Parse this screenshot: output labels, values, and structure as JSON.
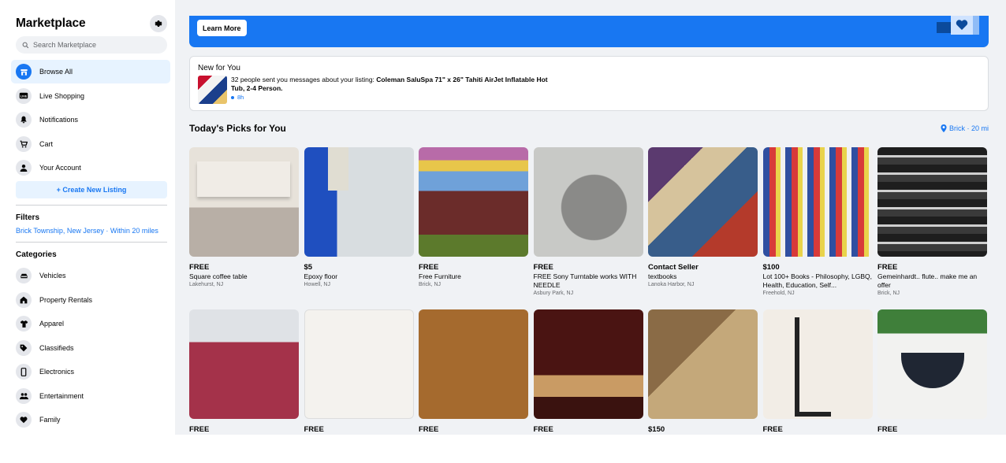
{
  "sidebar": {
    "title": "Marketplace",
    "search_placeholder": "Search Marketplace",
    "nav": [
      {
        "label": "Browse All",
        "icon": "storefront-icon",
        "active": true
      },
      {
        "label": "Live Shopping",
        "icon": "live-icon"
      },
      {
        "label": "Notifications",
        "icon": "bell-icon"
      },
      {
        "label": "Cart",
        "icon": "cart-icon"
      },
      {
        "label": "Your Account",
        "icon": "person-icon"
      }
    ],
    "create_listing": "+ Create New Listing",
    "filters_title": "Filters",
    "filter_location": "Brick Township, New Jersey · Within 20 miles",
    "categories_title": "Categories",
    "categories": [
      {
        "label": "Vehicles",
        "icon": "car-icon"
      },
      {
        "label": "Property Rentals",
        "icon": "house-icon"
      },
      {
        "label": "Apparel",
        "icon": "shirt-icon"
      },
      {
        "label": "Classifieds",
        "icon": "tag-icon"
      },
      {
        "label": "Electronics",
        "icon": "phone-icon"
      },
      {
        "label": "Entertainment",
        "icon": "people-icon"
      },
      {
        "label": "Family",
        "icon": "heart-icon"
      }
    ]
  },
  "banner": {
    "button_label": "Learn More"
  },
  "new_for_you": {
    "title": "New for You",
    "message_prefix": "32 people sent you messages about your listing: ",
    "message_bold": "Coleman SaluSpa 71\" x 26\" Tahiti AirJet Inflatable Hot Tub, 2-4 Person.",
    "time": "8h"
  },
  "picks": {
    "title": "Today's Picks for You",
    "location": "Brick · 20 mi",
    "items": [
      {
        "price": "FREE",
        "title": "Square coffee table",
        "location": "Lakehurst, NJ"
      },
      {
        "price": "$5",
        "title": "Epoxy floor",
        "location": "Howell, NJ"
      },
      {
        "price": "FREE",
        "title": "Free Furniture",
        "location": "Brick, NJ"
      },
      {
        "price": "FREE",
        "title": "FREE Sony Turntable works WITH NEEDLE",
        "location": "Asbury Park, NJ"
      },
      {
        "price": "Contact Seller",
        "title": "textbooks",
        "location": "Lanoka Harbor, NJ"
      },
      {
        "price": "$100",
        "title": "Lot 100+ Books - Philosophy, LGBQ, Health, Education, Self...",
        "location": "Freehold, NJ"
      },
      {
        "price": "FREE",
        "title": "Gemeinhardt.. flute.. make me an offer",
        "location": "Brick, NJ"
      },
      {
        "price": "FREE",
        "title": "",
        "location": ""
      },
      {
        "price": "FREE",
        "title": "",
        "location": ""
      },
      {
        "price": "FREE",
        "title": "",
        "location": ""
      },
      {
        "price": "FREE",
        "title": "",
        "location": ""
      },
      {
        "price": "$150",
        "title": "",
        "location": ""
      },
      {
        "price": "FREE",
        "title": "",
        "location": ""
      },
      {
        "price": "FREE",
        "title": "",
        "location": ""
      }
    ]
  },
  "colors": {
    "accent": "#1877f2",
    "page_bg": "#f0f2f5",
    "text": "#050505",
    "secondary_text": "#65676b"
  }
}
